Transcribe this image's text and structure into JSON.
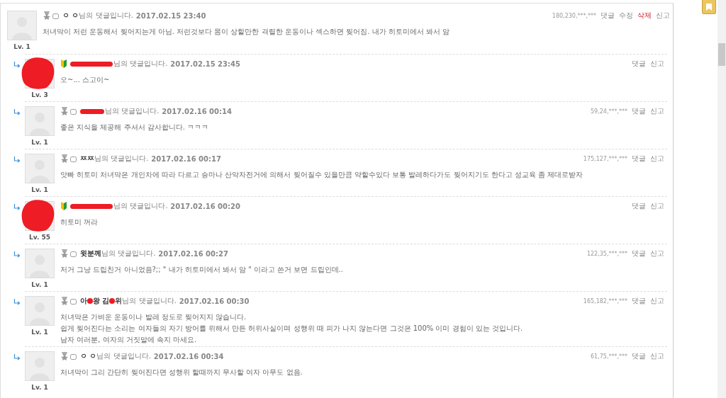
{
  "comments": [
    {
      "reply": false,
      "kind": "medal",
      "redact_avatar": false,
      "redact_name": false,
      "name_parts": [
        "ㅇ ㅇ"
      ],
      "suffix": "님의 댓글입니다.",
      "date": "2017.02.15 23:40",
      "level": "Lv. 1",
      "ip": "180,230,***,***",
      "actions": [
        {
          "label": "댓글",
          "kind": "normal"
        },
        {
          "label": "수정",
          "kind": "normal"
        },
        {
          "label": "삭제",
          "kind": "danger"
        },
        {
          "label": "신고",
          "kind": "normal"
        }
      ],
      "body": [
        "처녀막이 저런 운동해서 찢어지는게 아님. 저런것보다 몸이 상할만한 격렬한 운동이나 섹스하면 찢어짐. 내가 히토미에서 봐서 암"
      ]
    },
    {
      "reply": true,
      "kind": "beginner",
      "redact_avatar": true,
      "redact_name": true,
      "suffix": "님의 댓글입니다.",
      "date": "2017.02.15 23:45",
      "level": "Lv. 3",
      "actions": [
        {
          "label": "댓글",
          "kind": "normal"
        },
        {
          "label": "신고",
          "kind": "normal"
        }
      ],
      "body": [
        "오~... 스고이~"
      ]
    },
    {
      "reply": true,
      "kind": "medal",
      "redact_avatar": false,
      "redact_name": true,
      "suffix": "님의 댓글입니다.",
      "date": "2017.02.16 00:14",
      "level": "Lv. 1",
      "ip": "59,24,***,***",
      "actions": [
        {
          "label": "댓글",
          "kind": "normal"
        },
        {
          "label": "신고",
          "kind": "normal"
        }
      ],
      "body": [
        "좋은 지식을 제공해 주셔서 감사합니다. ㅋㅋㅋ"
      ]
    },
    {
      "reply": true,
      "kind": "medal",
      "redact_avatar": false,
      "redact_name": false,
      "name_parts": [
        "ㅉㅉ"
      ],
      "suffix": "님의 댓글입니다.",
      "date": "2017.02.16 00:17",
      "level": "Lv. 1",
      "ip": "175,127,***,***",
      "actions": [
        {
          "label": "댓글",
          "kind": "normal"
        },
        {
          "label": "신고",
          "kind": "normal"
        }
      ],
      "body": [
        "앗빠 히토미 처녀막은 개인차에 따라 다르고 승마나 산악자전거에 의해서 찢어질수 있을만큼 약할수있다 보통 발레하다가도 찢어지기도 한다고 성교육 좀 제대로받자"
      ]
    },
    {
      "reply": true,
      "kind": "beginner",
      "redact_avatar": true,
      "redact_name": true,
      "suffix": "님의 댓글입니다.",
      "date": "2017.02.16 00:20",
      "level": "Lv. 55",
      "actions": [
        {
          "label": "댓글",
          "kind": "normal"
        },
        {
          "label": "신고",
          "kind": "normal"
        }
      ],
      "body": [
        "히토미 꺼라"
      ]
    },
    {
      "reply": true,
      "kind": "medal",
      "redact_avatar": false,
      "redact_name": false,
      "name_parts": [
        "윗분께"
      ],
      "suffix": "님의 댓글입니다.",
      "date": "2017.02.16 00:27",
      "level": "Lv. 1",
      "ip": "122,35,***,***",
      "actions": [
        {
          "label": "댓글",
          "kind": "normal"
        },
        {
          "label": "신고",
          "kind": "normal"
        }
      ],
      "body": [
        "저거 그냥 드립친거 아니었음?;; \" 내가 히토미에서 봐서 암 \" 이라고 쓴거 보면 드립인데.."
      ]
    },
    {
      "reply": true,
      "kind": "medal",
      "redact_avatar": false,
      "redact_name": false,
      "name_parts": [
        "아",
        "왕 김",
        "위"
      ],
      "suffix": "님의 댓글입니다.",
      "date": "2017.02.16 00:30",
      "level": "Lv. 1",
      "ip": "165,182,***,***",
      "actions": [
        {
          "label": "댓글",
          "kind": "normal"
        },
        {
          "label": "신고",
          "kind": "normal"
        }
      ],
      "body": [
        "처녀막은 가벼운 운동이나 발레 정도로 찢어지지 않습니다.",
        "쉽게 찢어진다는 소리는 여자들의 자기 방어를 위해서 만든 허위사실이며 성행위 때 피가 나지 않는다면 그것은 100% 이미 경험이 있는 것입니다.",
        "남자 여러분, 여자의 거짓말에 속지 마세요."
      ]
    },
    {
      "reply": true,
      "kind": "medal",
      "redact_avatar": false,
      "redact_name": false,
      "name_parts": [
        "ㅇ ㅇ"
      ],
      "suffix": "님의 댓글입니다.",
      "date": "2017.02.16 00:34",
      "level": "Lv. 1",
      "ip": "61,75,***,***",
      "actions": [
        {
          "label": "댓글",
          "kind": "normal"
        },
        {
          "label": "신고",
          "kind": "normal"
        }
      ],
      "body": [
        "처녀막이 그리 간단히 찢어진다면 성행위 할때까지 무사할 여자 아무도 없음."
      ]
    }
  ]
}
